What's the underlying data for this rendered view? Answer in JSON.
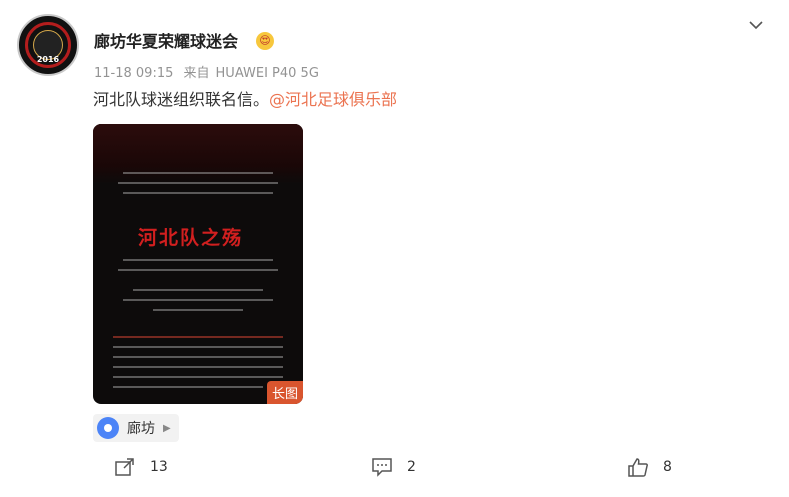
{
  "post": {
    "username": "廊坊华夏荣耀球迷会",
    "avatar_year": "2016",
    "emoji": "😍",
    "time": "11-18 09:15",
    "source_prefix": "来自",
    "source": "HUAWEI P40 5G",
    "text": "河北队球迷组织联名信。",
    "mention": "@河北足球俱乐部",
    "image_title": "河北队之殇",
    "image_badge": "长图",
    "location": "廊坊"
  },
  "actions": {
    "repost_count": "13",
    "comment_count": "2",
    "like_count": "8"
  },
  "icons": {
    "chevron": "chevron-down-icon",
    "repost": "share-icon",
    "comment": "comment-icon",
    "like": "thumbs-up-icon",
    "location": "location-pin-icon"
  },
  "colors": {
    "accent": "#eb7350",
    "meta": "#939393",
    "location_pin": "#4c84f7",
    "badge": "#d9552e"
  }
}
